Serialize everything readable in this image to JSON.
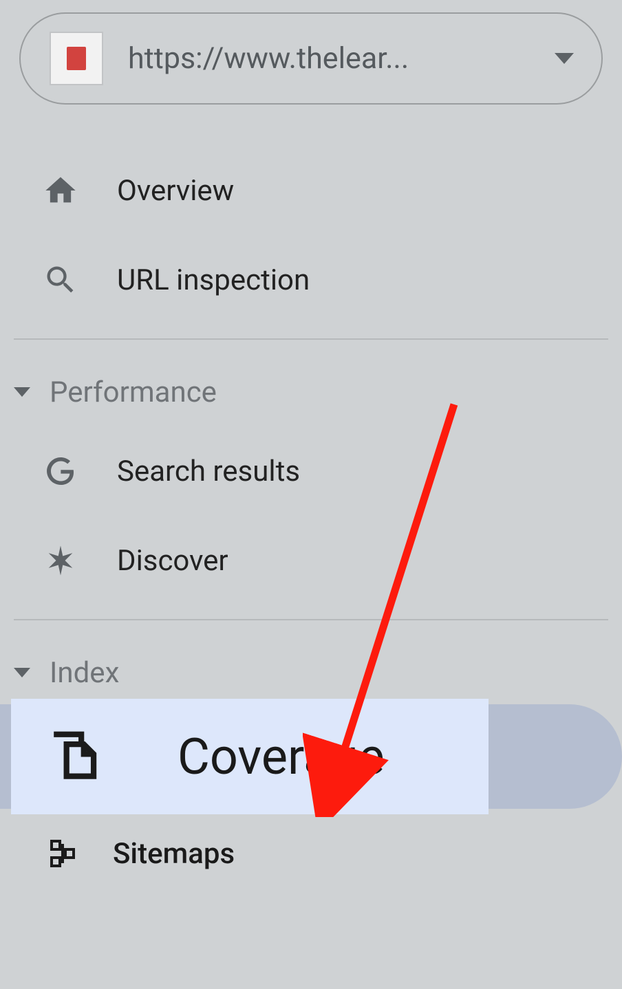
{
  "property_selector": {
    "url_text": "https://www.thelear..."
  },
  "nav": {
    "overview": "Overview",
    "url_inspection": "URL inspection"
  },
  "sections": {
    "performance": {
      "title": "Performance",
      "items": {
        "search_results": "Search results",
        "discover": "Discover"
      }
    },
    "index": {
      "title": "Index",
      "items": {
        "coverage": "Coverage",
        "sitemaps": "Sitemaps"
      }
    }
  }
}
